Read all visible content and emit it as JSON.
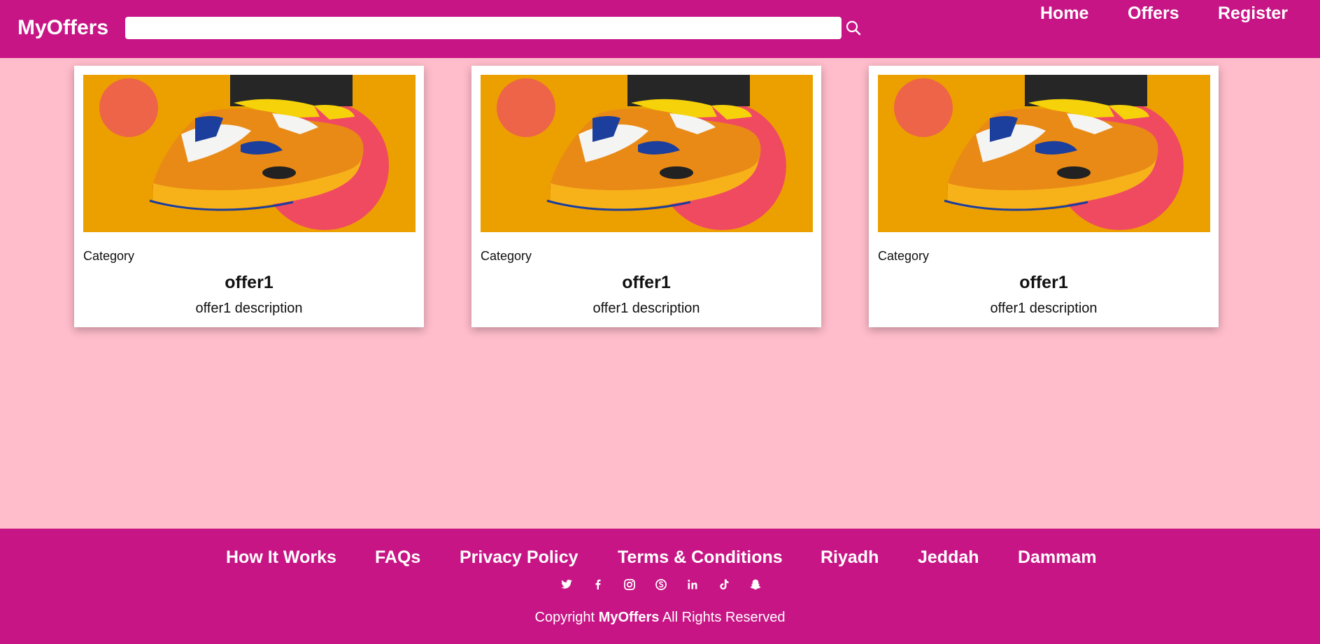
{
  "header": {
    "logo": "MyOffers",
    "search": {
      "value": "",
      "placeholder": ""
    },
    "nav": {
      "home": "Home",
      "offers": "Offers",
      "register": "Register"
    }
  },
  "cards": [
    {
      "category": "Category",
      "title": "offer1",
      "description": "offer1 description"
    },
    {
      "category": "Category",
      "title": "offer1",
      "description": "offer1 description"
    },
    {
      "category": "Category",
      "title": "offer1",
      "description": "offer1 description"
    }
  ],
  "footer": {
    "links": [
      "How It Works",
      "FAQs",
      "Privacy Policy",
      "Terms & Conditions",
      "Riyadh",
      "Jeddah",
      "Dammam"
    ],
    "social_icons": [
      "twitter-icon",
      "facebook-icon",
      "instagram-icon",
      "skype-icon",
      "linkedin-icon",
      "tiktok-icon",
      "snapchat-icon"
    ],
    "copyright_prefix": "Copyright",
    "copyright_brand": "MyOffers",
    "copyright_suffix": "All Rights Reserved"
  },
  "colors": {
    "brand": "#c71585",
    "page_background": "#ffbccb",
    "card_image_background": "#eca000"
  }
}
